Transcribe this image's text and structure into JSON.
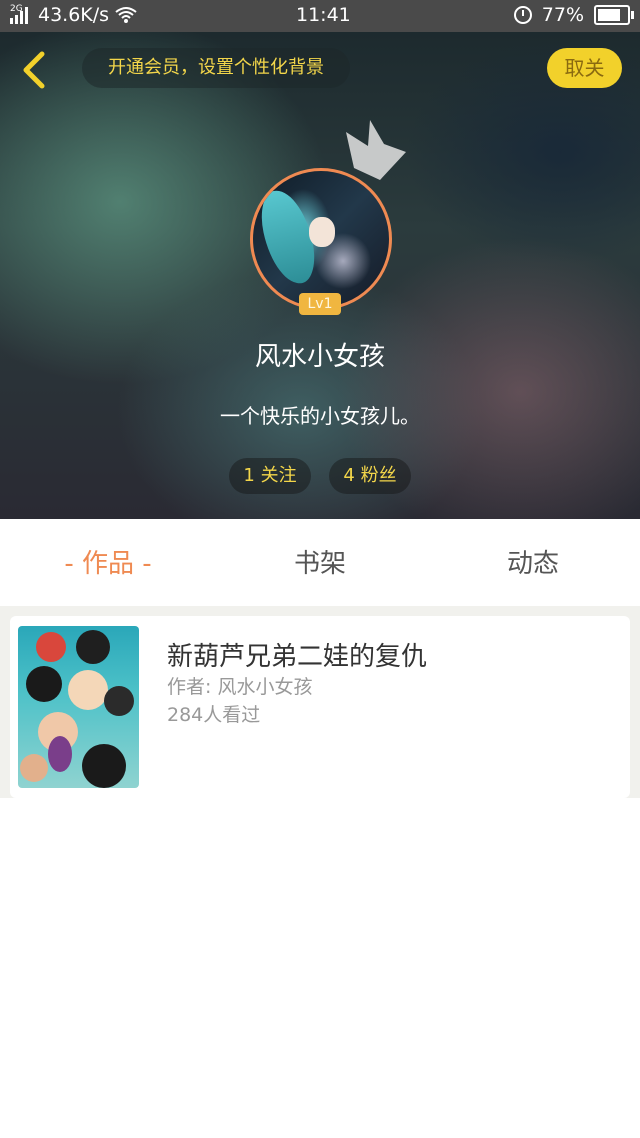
{
  "status_bar": {
    "network_type": "2G",
    "speed": "43.6K/s",
    "time": "11:41",
    "battery": "77%",
    "battery_level": 0.77
  },
  "header": {
    "promo_text": "开通会员，设置个性化背景",
    "close_label": "取关",
    "accent_color": "#f2d12b"
  },
  "profile": {
    "level": "Lv1",
    "username": "风水小女孩",
    "bio": "一个快乐的小女孩儿。",
    "following": "1 关注",
    "followers": "4 粉丝"
  },
  "tabs": [
    {
      "label": "- 作品 -",
      "active": true
    },
    {
      "label": "书架",
      "active": false
    },
    {
      "label": "动态",
      "active": false
    }
  ],
  "works": [
    {
      "title": "新葫芦兄弟二娃的复仇",
      "author": "作者: 风水小女孩",
      "views": "284人看过"
    }
  ],
  "colors": {
    "tab_active": "#ef8a52",
    "tab_inactive": "#555555"
  },
  "icons": {
    "back": "chevron-left-icon",
    "crown": "crown-icon",
    "wifi": "wifi-icon",
    "alarm": "alarm-icon",
    "battery": "battery-icon"
  }
}
